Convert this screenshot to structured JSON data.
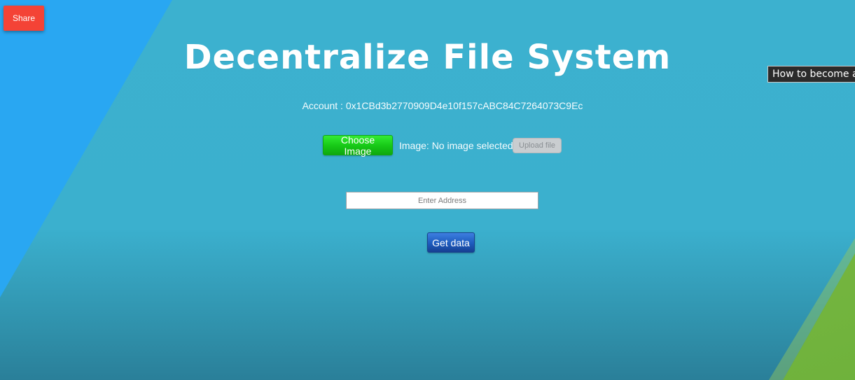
{
  "share_button": {
    "label": "Share"
  },
  "tooltip": {
    "text": "How to become a"
  },
  "app": {
    "title": "Decentralize File System",
    "account_label": "Account : 0x1CBd3b2770909D4e10f157cABC84C7264073C9Ec"
  },
  "upload": {
    "choose_label": "Choose Image",
    "status_text": "Image: No image selected",
    "upload_label": "Upload file"
  },
  "fetch": {
    "address_placeholder": "Enter Address",
    "address_value": "",
    "get_data_label": "Get data"
  },
  "colors": {
    "background": "#3cb1cf",
    "left_panel": "#29a7f2",
    "right_panel": "#6fb23c",
    "share": "#f44336",
    "choose": "#16c716",
    "get_data": "#1d5bbd",
    "upload_disabled": "#c9cdd0"
  }
}
